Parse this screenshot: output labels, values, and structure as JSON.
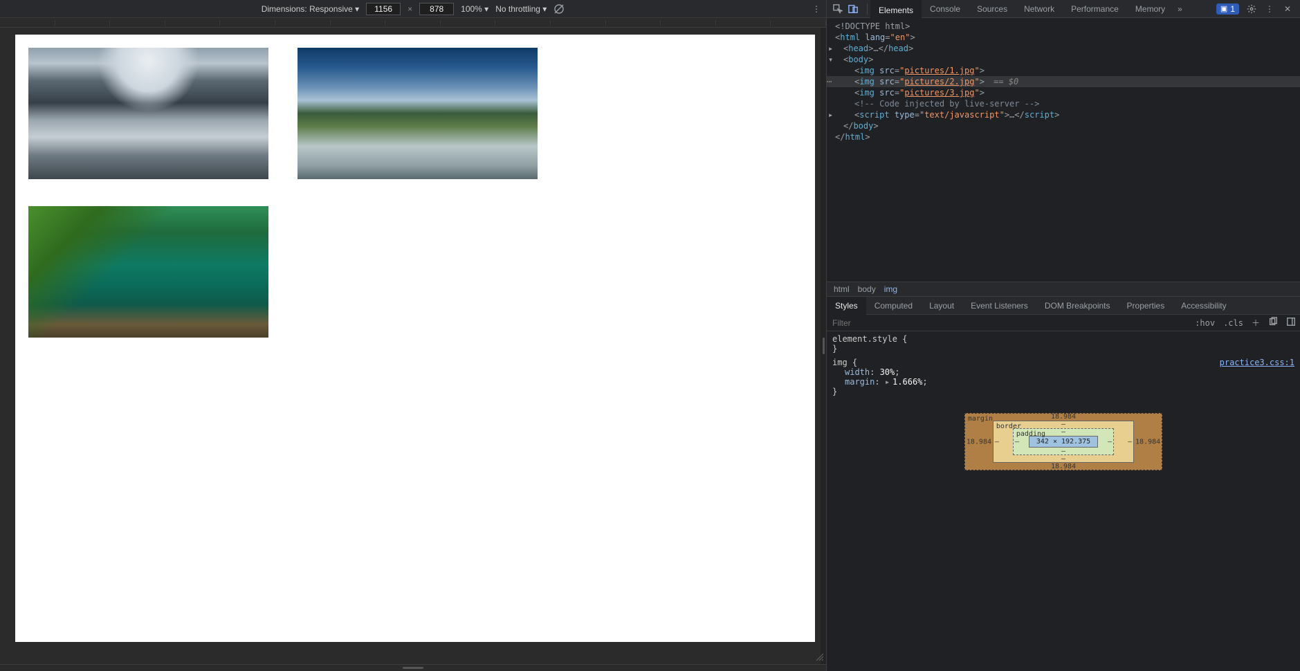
{
  "device_toolbar": {
    "dimensions_label": "Dimensions: Responsive ▾",
    "width": "1156",
    "height": "878",
    "zoom": "100% ▾",
    "throttling": "No throttling ▾"
  },
  "devtools_tabs": {
    "elements": "Elements",
    "console": "Console",
    "sources": "Sources",
    "network": "Network",
    "performance": "Performance",
    "memory": "Memory",
    "more": "»",
    "issues_count": "1"
  },
  "elements_tree": {
    "doctype": "<!DOCTYPE html>",
    "html_open": {
      "tag": "html",
      "attr": "lang",
      "val": "en"
    },
    "head": {
      "open": "head",
      "ell": "…",
      "close": "head"
    },
    "body_open": "body",
    "imgs": [
      {
        "tag": "img",
        "attr": "src",
        "val": "pictures/1.jpg"
      },
      {
        "tag": "img",
        "attr": "src",
        "val": "pictures/2.jpg"
      },
      {
        "tag": "img",
        "attr": "src",
        "val": "pictures/3.jpg"
      }
    ],
    "selected_suffix": " == $0",
    "comment": " Code injected by live-server ",
    "script": {
      "tag": "script",
      "attr": "type",
      "val": "text/javascript",
      "ell": "…"
    },
    "body_close": "body",
    "html_close": "html"
  },
  "breadcrumb": {
    "html": "html",
    "body": "body",
    "img": "img"
  },
  "sub_tabs": {
    "styles": "Styles",
    "computed": "Computed",
    "layout": "Layout",
    "ev": "Event Listeners",
    "dom": "DOM Breakpoints",
    "props": "Properties",
    "acc": "Accessibility"
  },
  "filter": {
    "placeholder": "Filter",
    "hov": ":hov",
    "cls": ".cls"
  },
  "styles_rules": {
    "element_style": "element.style {",
    "element_style_close": "}",
    "img_rule": "img {",
    "source": "practice3.css:1",
    "width_prop": "width",
    "width_val": "30%",
    "margin_prop": "margin",
    "margin_val": "1.666%",
    "img_close": "}"
  },
  "box_model": {
    "margin_label": "margin",
    "border_label": "border",
    "padding_label": "padding",
    "margin_t": "18.984",
    "margin_r": "18.984",
    "margin_b": "18.984",
    "margin_l": "18.984",
    "border_v": "–",
    "padding_v": "–",
    "content": "342 × 192.375"
  }
}
